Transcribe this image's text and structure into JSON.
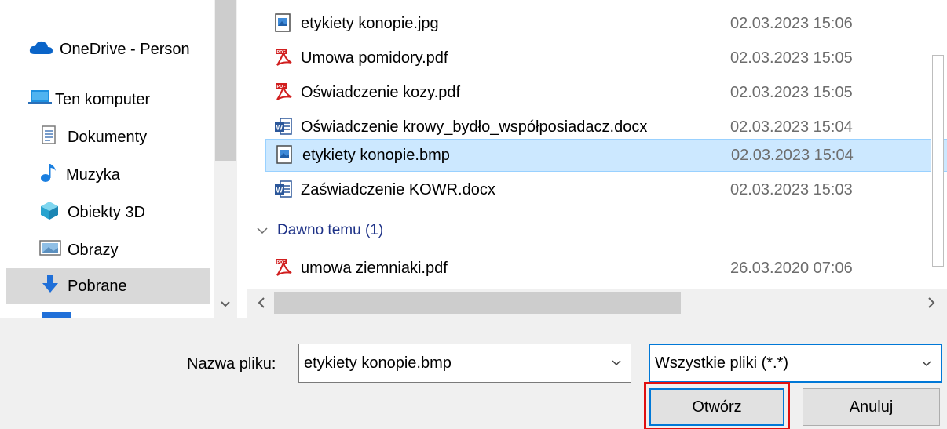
{
  "nav": {
    "items": [
      {
        "label": "OneDrive - Person",
        "icon": "onedrive-cloud-icon"
      },
      {
        "label": "Ten komputer",
        "icon": "computer-icon"
      },
      {
        "label": "Dokumenty",
        "icon": "documents-icon"
      },
      {
        "label": "Muzyka",
        "icon": "music-icon"
      },
      {
        "label": "Obiekty 3D",
        "icon": "3d-objects-icon"
      },
      {
        "label": "Obrazy",
        "icon": "pictures-icon"
      },
      {
        "label": "Pobrane",
        "icon": "downloads-icon",
        "selected": true
      }
    ]
  },
  "files": {
    "recent": [
      {
        "name": "etykiety konopie.jpg",
        "date": "02.03.2023 15:06",
        "icon": "image-file-icon"
      },
      {
        "name": "Umowa pomidory.pdf",
        "date": "02.03.2023 15:05",
        "icon": "pdf-file-icon"
      },
      {
        "name": "Oświadczenie kozy.pdf",
        "date": "02.03.2023 15:05",
        "icon": "pdf-file-icon"
      },
      {
        "name": "Oświadczenie krowy_bydło_współposiadacz.docx",
        "date": "02.03.2023 15:04",
        "icon": "word-file-icon"
      },
      {
        "name": "etykiety konopie.bmp",
        "date": "02.03.2023 15:04",
        "icon": "image-file-icon",
        "selected": true
      },
      {
        "name": "Zaświadczenie KOWR.docx",
        "date": "02.03.2023 15:03",
        "icon": "word-file-icon"
      }
    ],
    "older_group": {
      "title": "Dawno temu (1)"
    },
    "older": [
      {
        "name": "umowa ziemniaki.pdf",
        "date": "26.03.2020 07:06",
        "icon": "pdf-file-icon"
      }
    ]
  },
  "bottom": {
    "filename_label": "Nazwa pliku:",
    "filename_value": "etykiety konopie.bmp",
    "filetype_value": "Wszystkie pliki (*.*)",
    "open_label": "Otwórz",
    "cancel_label": "Anuluj"
  },
  "colors": {
    "accent": "#0078d7",
    "selection_bg": "#cce8ff",
    "highlight_box": "#e01010",
    "group_title": "#1e3287"
  }
}
